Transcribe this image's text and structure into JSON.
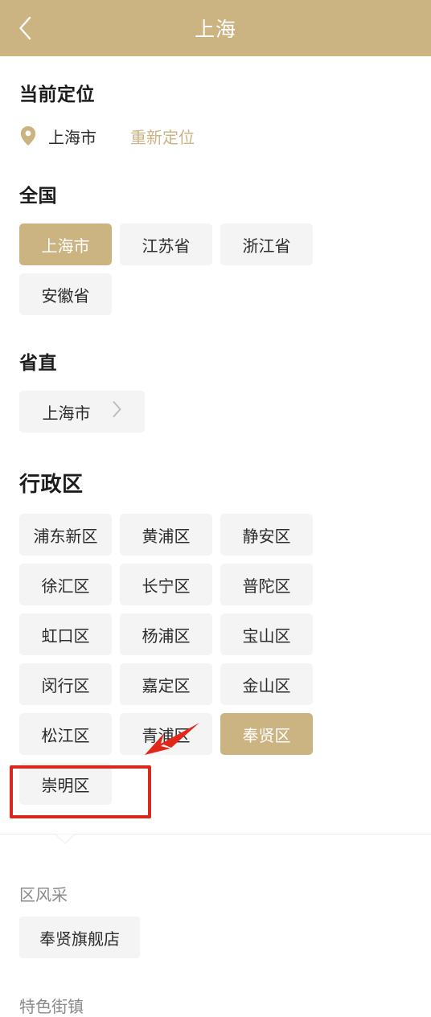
{
  "header": {
    "title": "上海",
    "back_icon": "chevron-left-icon",
    "bg_color": "#cbb382",
    "title_color": "#ffffff"
  },
  "current_location": {
    "title": "当前定位",
    "pin_icon": "map-pin-icon",
    "city": "上海市",
    "relocate_label": "重新定位",
    "accent_color": "#cbb382"
  },
  "national": {
    "title": "全国",
    "items": [
      {
        "label": "上海市",
        "selected": true
      },
      {
        "label": "江苏省",
        "selected": false
      },
      {
        "label": "浙江省",
        "selected": false
      },
      {
        "label": "安徽省",
        "selected": false
      }
    ]
  },
  "province_direct": {
    "title": "省直",
    "items": [
      {
        "label": "上海市",
        "selected": false,
        "chevron_icon": "chevron-right-icon"
      }
    ]
  },
  "districts": {
    "title": "行政区",
    "items": [
      {
        "label": "浦东新区",
        "selected": false
      },
      {
        "label": "黄浦区",
        "selected": false
      },
      {
        "label": "静安区",
        "selected": false
      },
      {
        "label": "徐汇区",
        "selected": false
      },
      {
        "label": "长宁区",
        "selected": false
      },
      {
        "label": "普陀区",
        "selected": false
      },
      {
        "label": "虹口区",
        "selected": false
      },
      {
        "label": "杨浦区",
        "selected": false
      },
      {
        "label": "宝山区",
        "selected": false
      },
      {
        "label": "闵行区",
        "selected": false
      },
      {
        "label": "嘉定区",
        "selected": false
      },
      {
        "label": "金山区",
        "selected": false
      },
      {
        "label": "松江区",
        "selected": false
      },
      {
        "label": "青浦区",
        "selected": false
      },
      {
        "label": "奉贤区",
        "selected": true
      },
      {
        "label": "崇明区",
        "selected": false
      }
    ]
  },
  "bottom": {
    "district_style_label": "区风采",
    "store_chip_label": "奉贤旗舰店",
    "featured_towns_label": "特色街镇"
  },
  "annotation": {
    "box_color": "#d8291c",
    "arrow_color": "#e02718",
    "arrow_icon": "arrow-pointing-down-left-icon"
  }
}
